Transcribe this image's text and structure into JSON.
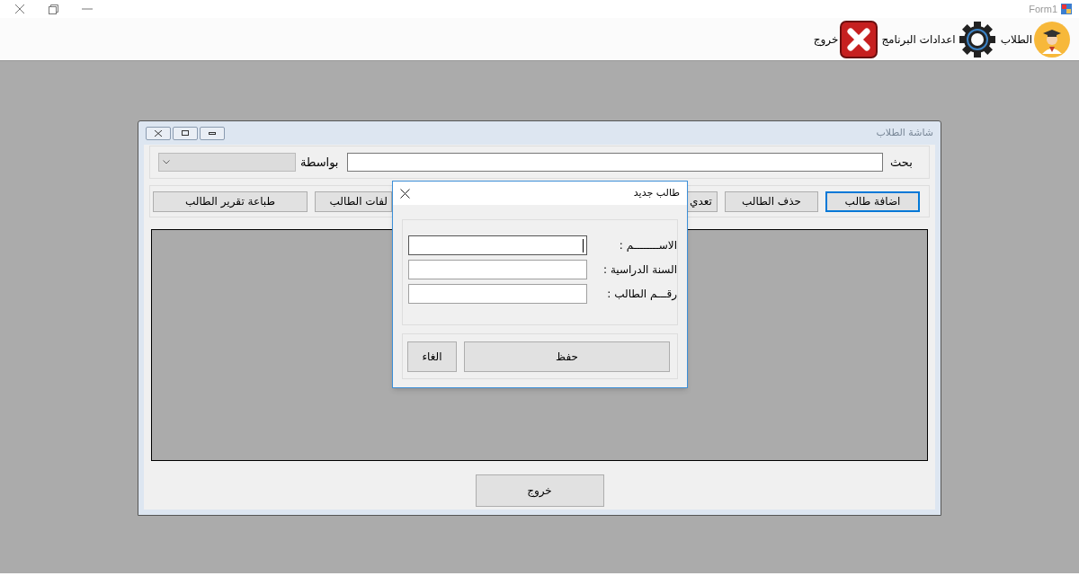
{
  "window": {
    "title": "Form1"
  },
  "toolbar": [
    {
      "kind": "student",
      "label": "الطلاب"
    },
    {
      "kind": "settings",
      "label": "اعدادات البرنامج"
    },
    {
      "kind": "exit",
      "label": "خروج"
    }
  ],
  "child_window": {
    "title": "شاشة الطلاب",
    "search_label": "بحث",
    "by_label": "بواسطة",
    "by_combo": {
      "disabled": true
    },
    "buttons": [
      {
        "label": "اضافة طالب",
        "focused": true
      },
      {
        "label": "حذف الطالب",
        "focused": false
      },
      {
        "label": "تعدي",
        "focused": false
      },
      {
        "label": "لفات الطالب",
        "focused": false
      },
      {
        "label": "طباعة تقرير الطالب",
        "focused": false
      }
    ],
    "exit_button": "خروج"
  },
  "dialog": {
    "title": "طالب جديد",
    "fields": [
      {
        "label": "الاســــــــم :",
        "focused": true
      },
      {
        "label": "السنة الدراسية :",
        "focused": false
      },
      {
        "label": "رقـــم الطالب :",
        "focused": false
      }
    ],
    "buttons": [
      {
        "kind": "save",
        "label": "حفظ"
      },
      {
        "kind": "cancel",
        "label": "الغاء"
      }
    ]
  }
}
